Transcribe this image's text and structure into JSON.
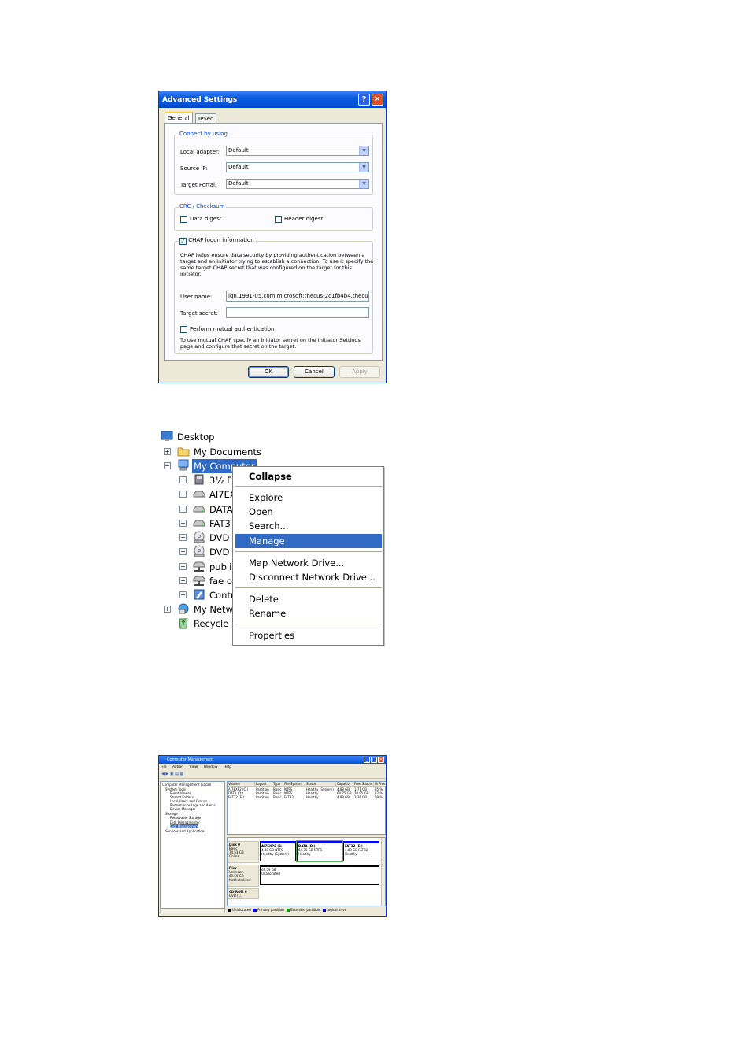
{
  "advanced_settings": {
    "title": "Advanced Settings",
    "tabs": [
      "General",
      "IPSec"
    ],
    "connect_group": {
      "legend": "Connect by using",
      "fields": [
        {
          "label": "Local adapter:",
          "value": "Default"
        },
        {
          "label": "Source IP:",
          "value": "Default"
        },
        {
          "label": "Target Portal:",
          "value": "Default"
        }
      ]
    },
    "crc_group": {
      "legend": "CRC / Checksum",
      "data_digest": {
        "label": "Data digest",
        "checked": false
      },
      "header_digest": {
        "label": "Header digest",
        "checked": false
      }
    },
    "chap_group": {
      "legend": "CHAP logon information",
      "checked": true,
      "description": "CHAP helps ensure data security by providing authentication between a target and an initiator trying to establish a connection. To use it specify the same target CHAP secret that was configured on the target for this initiator.",
      "user_name_label": "User name:",
      "user_name_value": "iqn.1991-05.com.microsoft:thecus-2c1fb4b4.thecus.",
      "target_secret_label": "Target secret:",
      "target_secret_value": "",
      "mutual_label": "Perform mutual authentication",
      "mutual_checked": false,
      "mutual_note": "To use mutual CHAP specify an initiator secret on the Initiator Settings page and configure that secret on the target."
    },
    "buttons": {
      "ok": "OK",
      "cancel": "Cancel",
      "apply": "Apply"
    },
    "check_glyph": "✓"
  },
  "explorer": {
    "tree": [
      {
        "label": "Desktop",
        "icon": "desktop-icon",
        "expander": ""
      },
      {
        "label": "My Documents",
        "icon": "folder-icon",
        "expander": "+"
      },
      {
        "label": "My Computer",
        "icon": "computer-icon",
        "expander": "−",
        "selected": true
      },
      {
        "label": "3½ F",
        "icon": "floppy-icon",
        "expander": "+"
      },
      {
        "label": "AI7EX",
        "icon": "drive-icon",
        "expander": "+"
      },
      {
        "label": "DATA",
        "icon": "drive-icon",
        "expander": "+"
      },
      {
        "label": "FAT3",
        "icon": "drive-icon",
        "expander": "+"
      },
      {
        "label": "DVD D",
        "icon": "dvd-icon",
        "expander": "+"
      },
      {
        "label": "DVD D",
        "icon": "dvd-icon",
        "expander": "+"
      },
      {
        "label": "public",
        "icon": "network-drive-icon",
        "expander": "+"
      },
      {
        "label": "fae o",
        "icon": "network-drive-icon",
        "expander": "+"
      },
      {
        "label": "Contr",
        "icon": "control-panel-icon",
        "expander": "+"
      },
      {
        "label": "My Netwo",
        "icon": "network-places-icon",
        "expander": "+"
      },
      {
        "label": "Recycle B",
        "icon": "recycle-bin-icon",
        "expander": ""
      }
    ],
    "context_menu": {
      "collapse": "Collapse",
      "explore": "Explore",
      "open": "Open",
      "search": "Search...",
      "manage": "Manage",
      "map_drive": "Map Network Drive...",
      "disconnect_drive": "Disconnect Network Drive...",
      "delete": "Delete",
      "rename": "Rename",
      "properties": "Properties"
    }
  },
  "computer_management": {
    "title": "Computer Management",
    "menu": [
      "File",
      "Action",
      "View",
      "Window",
      "Help"
    ],
    "tree": [
      {
        "label": "Computer Management (Local)"
      },
      {
        "label": "System Tools"
      },
      {
        "label": "Event Viewer"
      },
      {
        "label": "Shared Folders"
      },
      {
        "label": "Local Users and Groups"
      },
      {
        "label": "Performance Logs and Alerts"
      },
      {
        "label": "Device Manager"
      },
      {
        "label": "Storage"
      },
      {
        "label": "Removable Storage"
      },
      {
        "label": "Disk Defragmenter"
      },
      {
        "label": "Disk Management",
        "selected": true
      },
      {
        "label": "Services and Applications"
      }
    ],
    "columns": [
      "Volume",
      "Layout",
      "Type",
      "File System",
      "Status",
      "Capacity",
      "Free Space",
      "% Free"
    ],
    "rows": [
      [
        "AI7EXP2 (C:)",
        "Partition",
        "Basic",
        "NTFS",
        "Healthy (System)",
        "4.88 GB",
        "1.71 GB",
        "35 %"
      ],
      [
        "DATA (D:)",
        "Partition",
        "Basic",
        "NTFS",
        "Healthy",
        "64.75 GB",
        "20.95 GB",
        "32 %"
      ],
      [
        "FAT32 (E:)",
        "Partition",
        "Basic",
        "FAT32",
        "Healthy",
        "4.88 GB",
        "3.36 GB",
        "69 %"
      ]
    ],
    "disks": [
      {
        "name": "Disk 0",
        "lines": [
          "Basic",
          "74.53 GB",
          "Online"
        ]
      },
      {
        "name": "Disk 1",
        "lines": [
          "Unknown",
          "69.59 GB",
          "Not Initialized"
        ]
      },
      {
        "name": "CD-ROM 0",
        "lines": [
          "DVD (L:)"
        ]
      }
    ],
    "partitions": [
      {
        "name": "AI7EXP2 (C:)",
        "size": "4.88 GB NTFS",
        "status": "Healthy (System)"
      },
      {
        "name": "DATA (D:)",
        "size": "64.75 GB NTFS",
        "status": "Healthy"
      },
      {
        "name": "FAT32 (E:)",
        "size": "4.89 GB FAT32",
        "status": "Healthy"
      }
    ],
    "disk1_space": {
      "size": "69.59 GB",
      "status": "Unallocated"
    },
    "legend": [
      "Unallocated",
      "Primary partition",
      "Extended partition",
      "Logical drive"
    ],
    "legend_colors": [
      "#000000",
      "#0000ff",
      "#00a000",
      "#0000c0"
    ]
  }
}
